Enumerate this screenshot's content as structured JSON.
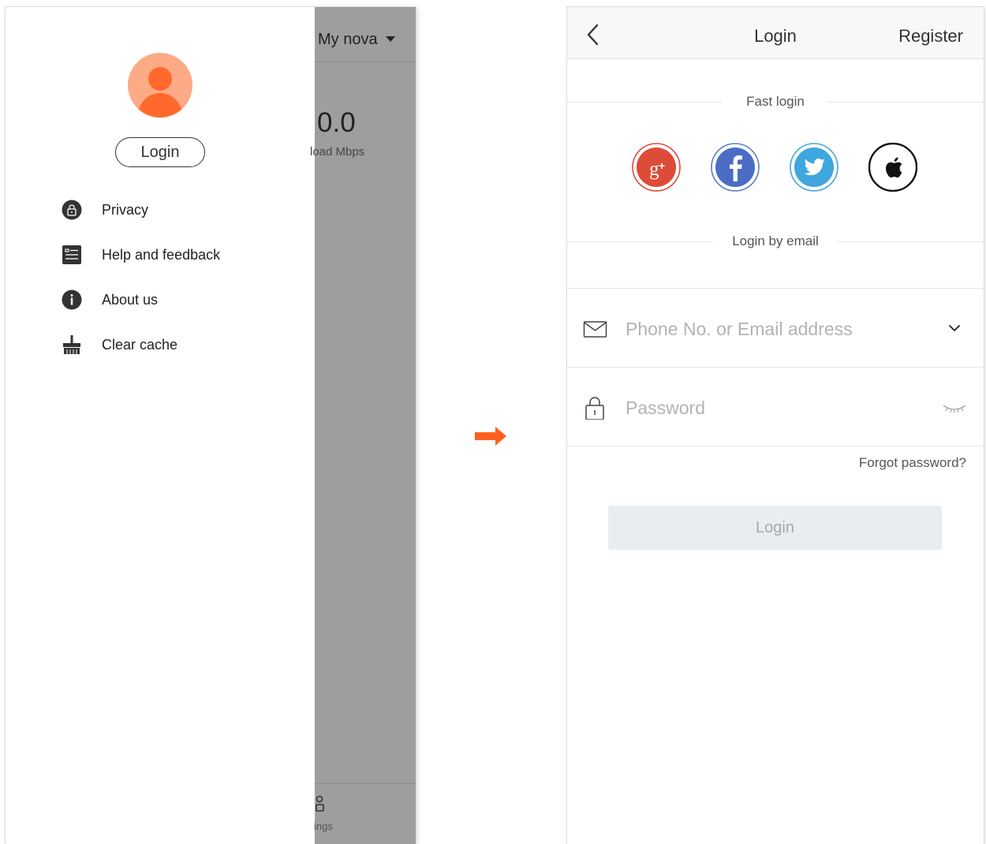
{
  "left_screen": {
    "drawer": {
      "login_label": "Login",
      "menu": [
        {
          "label": "Privacy",
          "icon": "lock-icon"
        },
        {
          "label": "Help and feedback",
          "icon": "list-icon"
        },
        {
          "label": "About us",
          "icon": "info-icon"
        },
        {
          "label": "Clear cache",
          "icon": "broom-icon"
        }
      ]
    },
    "background_app": {
      "network_name": "My nova",
      "speed_value": "0.0",
      "speed_label": "load Mbps",
      "bottom_tab_label": "ings"
    }
  },
  "transition_arrow": "arrow-right-icon",
  "right_screen": {
    "nav": {
      "title": "Login",
      "register": "Register"
    },
    "fast_login_label": "Fast login",
    "social_buttons": [
      "google-plus-icon",
      "facebook-icon",
      "twitter-icon",
      "apple-icon"
    ],
    "email_login_label": "Login by email",
    "account_field": {
      "value": "",
      "placeholder": "Phone No. or Email address"
    },
    "password_field": {
      "value": "",
      "placeholder": "Password"
    },
    "forgot_password": "Forgot password?",
    "login_button": "Login"
  },
  "colors": {
    "accent_orange": "#ff5f1f",
    "avatar_bg": "#fdaa86",
    "google": "#dd4b39",
    "facebook": "#3b5998",
    "twitter": "#1da1f2",
    "overlay": "#9e9e9e"
  }
}
